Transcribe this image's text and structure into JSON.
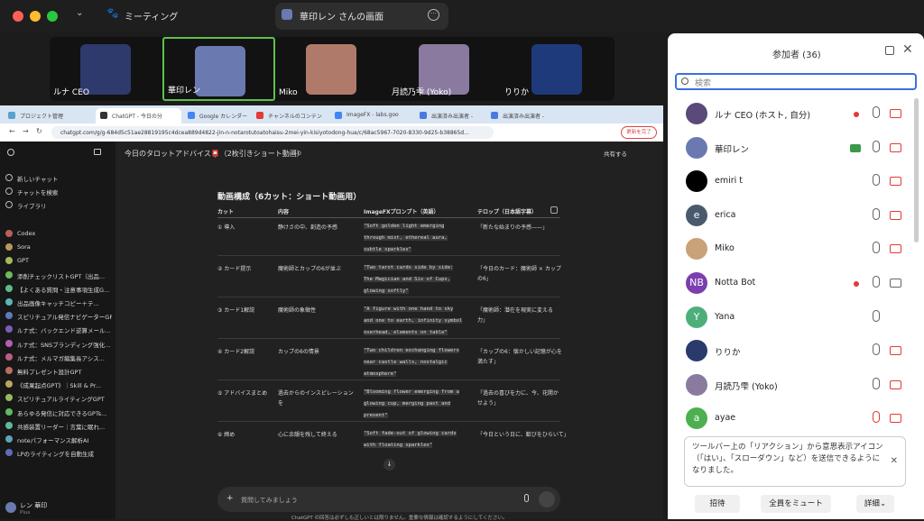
{
  "meeting": {
    "title": "ミーティング",
    "share_title": "華印レン さんの画面"
  },
  "colors": {
    "accent": "#3b6fe0",
    "active_tile": "#5ec14a",
    "record": "#e53935"
  },
  "video_tiles": [
    "ルナ CEO",
    "華印レン",
    "Miko",
    "月読乃雫 (Yoko)",
    "りりか"
  ],
  "browser": {
    "tabs": [
      "プロジェクト管理",
      "ChatGPT - 今日の分",
      "Google カレンダー",
      "チャンネルのコンテン",
      "ImageFX - labs.goo",
      "出演済み出演者 -",
      "出演済み出演者 -"
    ],
    "url": "chatgpt.com/g/g-684d5c51ae28819195c4dcea889d4822-jin-n-notarotutoatohaisu-2mei-yin-kisiyotodong-hua/c/68ac5967-7020-8330-9d25-b38865d...",
    "update_label": "更新を完了"
  },
  "sidebar": {
    "top": [
      "新しいチャット",
      "チャットを検索",
      "ライブラリ"
    ],
    "gpts": [
      "Codex",
      "Sora",
      "GPT",
      "添削チェックリストGPT（出品...",
      "【よくある質問・注意事項生成G...",
      "出品画像キャッチコピー＋テ...",
      "スピリチュアル発信ナビゲーターGPT",
      "ルナ式：バックエンド逆算メール...",
      "ルナ式：SNSブランディング強化...",
      "ルナ式：メルマガ編集長アシス...",
      "無料プレゼント設計GPT",
      "《成果起点GPT》｜Skill & Pr...",
      "スピリチュアルライティングGPT",
      "あらゆる発信に対応できるGPTs...",
      "共感装置リーダー｜言葉に眠れ...",
      "noteパフォーマンス解析AI",
      "LPのライティングを自動生成"
    ],
    "user": "レン 華印",
    "plan": "Plus"
  },
  "chat": {
    "title": "今日のタロットアドバイス📮（2枚引きショート動画）",
    "model": "4o",
    "share": "共有する",
    "table_title": "動画構成（6カット：ショート動画用）",
    "headers": [
      "カット",
      "内容",
      "ImageFXプロンプト（英語）",
      "テロップ（日本語字幕）"
    ],
    "rows": [
      {
        "cut": "① 導入",
        "content": "静けさの中、創造の予感",
        "prompt": [
          "\"Soft golden light emerging",
          "through mist, ethereal aura,",
          "subtle sparkles\""
        ],
        "caption": [
          "「新たな始まりの予感——」"
        ]
      },
      {
        "cut": "② カード提示",
        "content": "魔術師とカップの6が並ぶ",
        "prompt": [
          "\"Two tarot cards side by side:",
          "The Magician and Six of Cups,",
          "glowing softly\""
        ],
        "caption": [
          "「今日のカード：魔術師 × カップ",
          "の6」"
        ]
      },
      {
        "cut": "③ カード1解説",
        "content": "魔術師の象徴性",
        "prompt": [
          "\"A figure with one hand to sky",
          "and one to earth, infinity symbol",
          "overhead, elements on table\""
        ],
        "caption": [
          "「魔術師：潜在を現実に変える",
          "力」"
        ]
      },
      {
        "cut": "④ カード2解説",
        "content": "カップの6の情景",
        "prompt": [
          "\"Two children exchanging flowers",
          "near castle walls, nostalgic",
          "atmosphere\""
        ],
        "caption": [
          "「カップの6：懐かしい記憶が心を",
          "満たす」"
        ]
      },
      {
        "cut": "⑤ アドバイスまとめ",
        "content": [
          "過去からのインスピレーション",
          "を"
        ],
        "prompt": [
          "\"Blooming flower emerging from a",
          "glowing cup, merging past and",
          "present\""
        ],
        "caption": [
          "「過去の喜びを力に、今、花開か",
          "せよう」"
        ]
      },
      {
        "cut": "⑥ 締め",
        "content": "心に余韻を残して終える",
        "prompt": [
          "\"Soft fade-out of glowing cards",
          "with floating sparkles\""
        ],
        "caption": [
          "「今日という日に、歓びをひらいて」"
        ]
      }
    ],
    "composer_placeholder": "質問してみましょう",
    "footer": "ChatGPT の回答は必ずしも正しいとは限りません。重要な情報は確認するようにしてください。"
  },
  "participants": {
    "title": "参加者 (36)",
    "search_placeholder": "検索",
    "list": [
      {
        "name": "ルナ CEO (ホスト, 自分)",
        "initial": "",
        "color": "#5a4a7a",
        "rec": true,
        "mic_muted": false,
        "cam_off": true
      },
      {
        "name": "華印レン",
        "initial": "",
        "color": "#6a7ab0",
        "rec": false,
        "share": true,
        "mic_muted": false,
        "cam_off": true
      },
      {
        "name": "emiri t",
        "initial": "",
        "color": "#000000",
        "rec": false,
        "mic_muted": false,
        "cam_off": true
      },
      {
        "name": "erica",
        "initial": "e",
        "color": "#4a5a6e",
        "rec": false,
        "mic_muted": false,
        "cam_off": true
      },
      {
        "name": "Miko",
        "initial": "",
        "color": "#c9a27a",
        "rec": false,
        "mic_muted": false,
        "cam_off": true
      },
      {
        "name": "Notta Bot",
        "initial": "NB",
        "color": "#7b3fb0",
        "rec": true,
        "mic_muted": false,
        "cam_off": false
      },
      {
        "name": "Yana",
        "initial": "Y",
        "color": "#4caf7a",
        "rec": false,
        "mic_muted": false,
        "cam_off": null
      },
      {
        "name": "りりか",
        "initial": "",
        "color": "#2a3a6a",
        "rec": false,
        "mic_muted": false,
        "cam_off": true
      },
      {
        "name": "月読乃雫 (Yoko)",
        "initial": "",
        "color": "#8a7aa0",
        "rec": false,
        "mic_muted": false,
        "cam_off": true
      },
      {
        "name": "ayae",
        "initial": "a",
        "color": "#4caf50",
        "rec": false,
        "mic_muted": true,
        "cam_off": true
      }
    ],
    "toast": "ツールバー上の「リアクション」から意思表示アイコン（「はい」、「スローダウン」など）を送信できるようになりました。",
    "buttons": [
      "招待",
      "全員をミュート",
      "詳細"
    ]
  }
}
